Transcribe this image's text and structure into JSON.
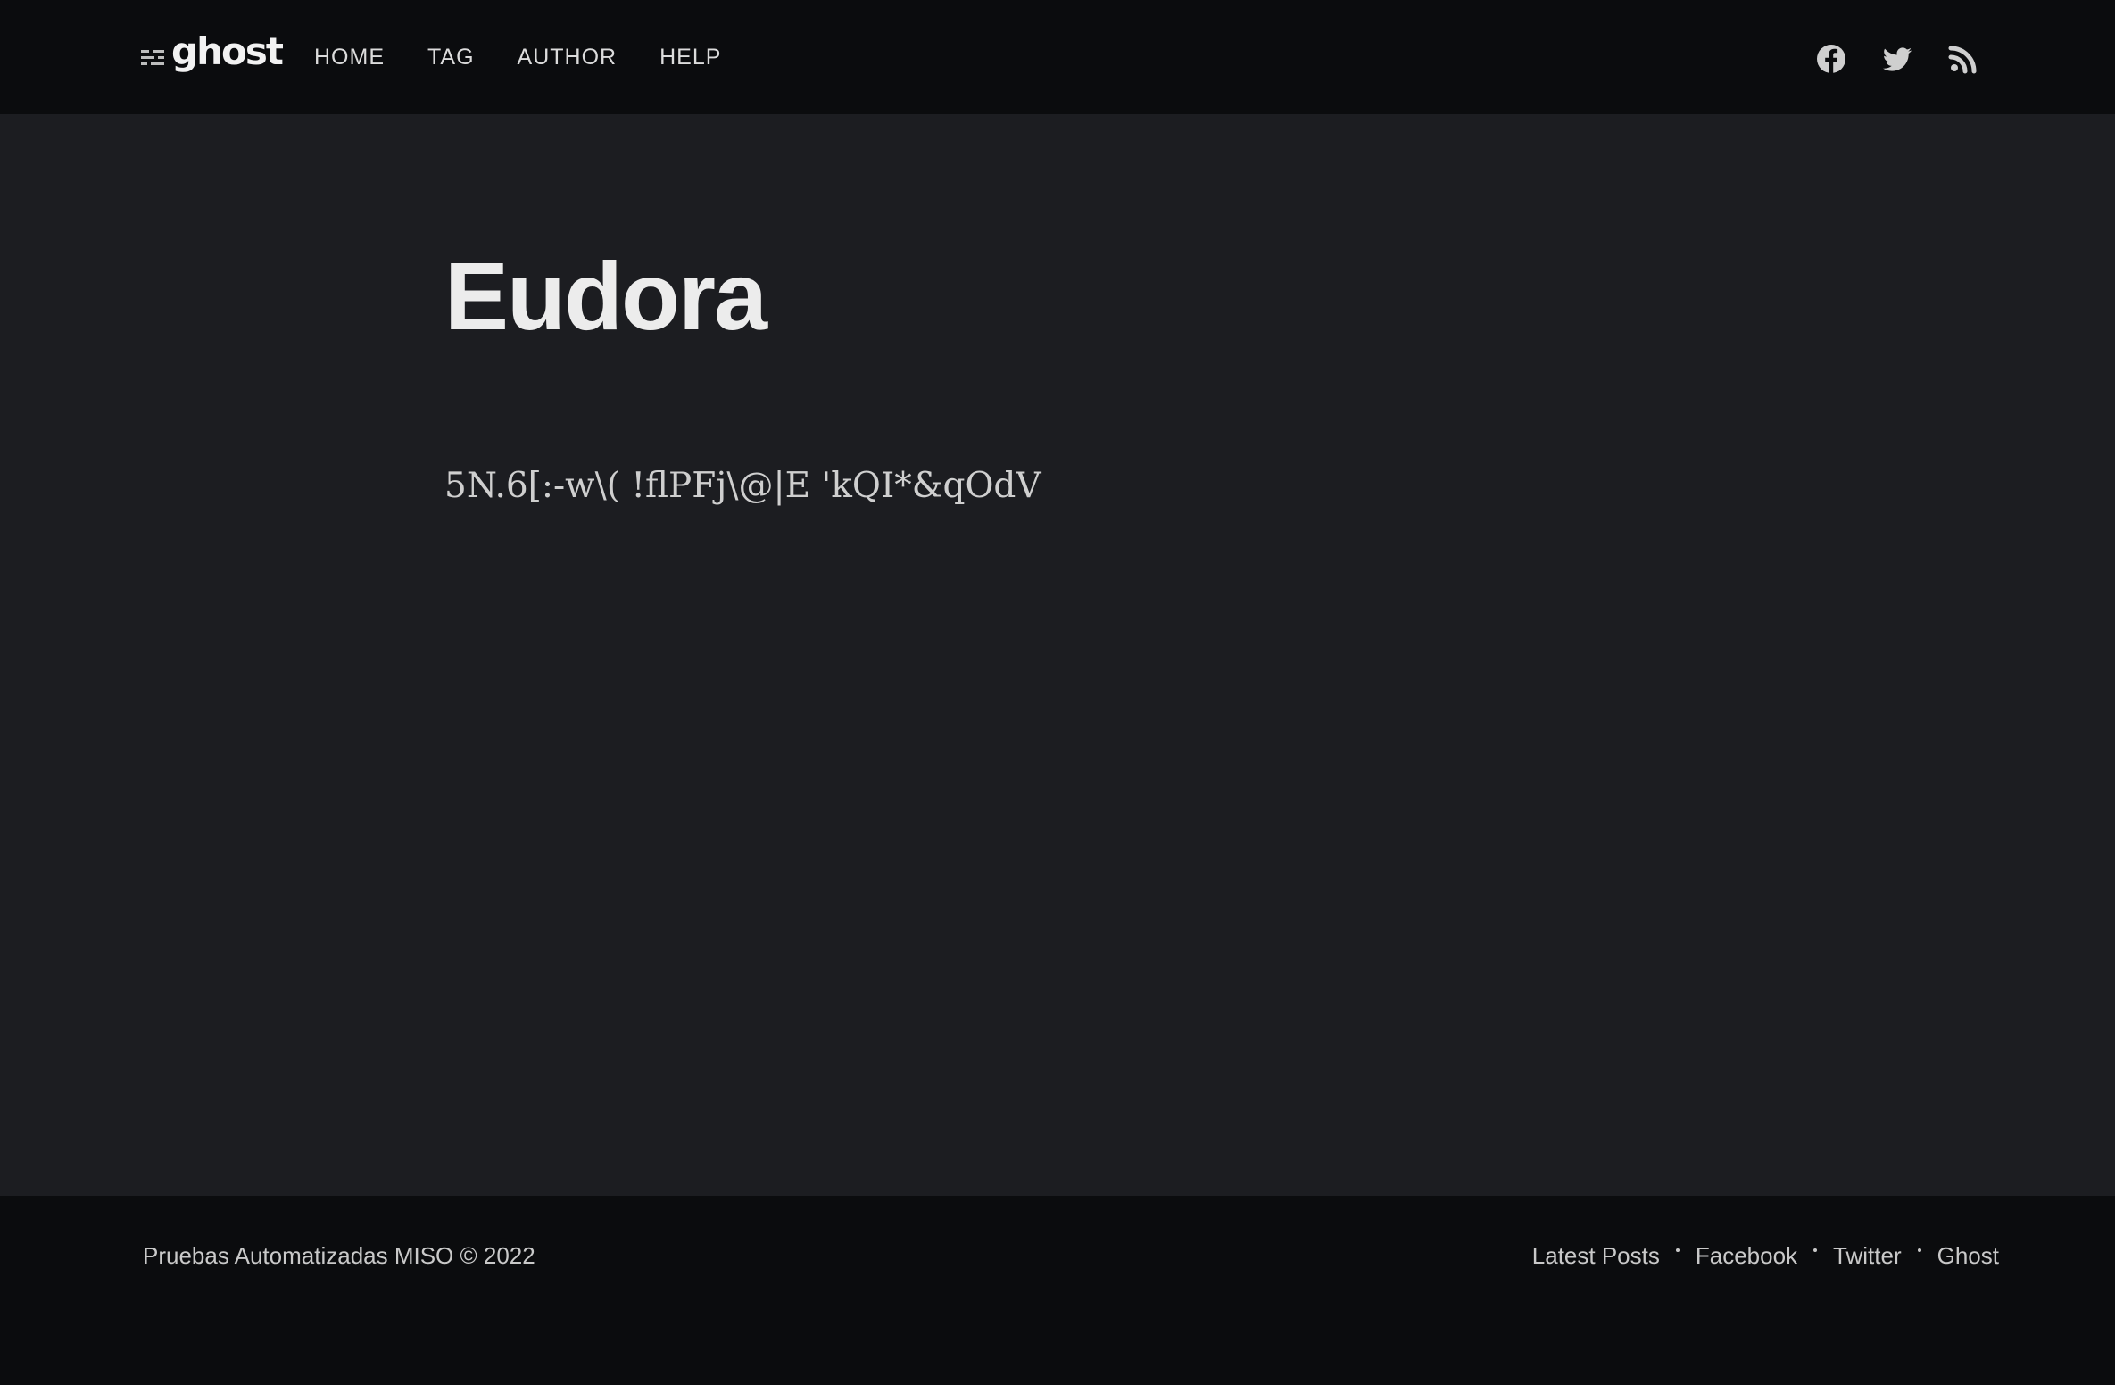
{
  "header": {
    "logo_text": "ghost",
    "nav": [
      {
        "label": "HOME"
      },
      {
        "label": "TAG"
      },
      {
        "label": "AUTHOR"
      },
      {
        "label": "HELP"
      }
    ],
    "social_icons": [
      "facebook-icon",
      "twitter-icon",
      "rss-icon"
    ]
  },
  "post": {
    "title": "Eudora",
    "content": "5N.6[:-w\\( !flPFj\\@|E 'kQI*&qOdV"
  },
  "footer": {
    "copyright": "Pruebas Automatizadas MISO © 2022",
    "links": [
      {
        "label": "Latest Posts"
      },
      {
        "label": "Facebook"
      },
      {
        "label": "Twitter"
      },
      {
        "label": "Ghost"
      }
    ]
  },
  "colors": {
    "header_bg": "#0b0c0e",
    "page_bg": "#1c1d21",
    "text": "#e8e8e8"
  }
}
